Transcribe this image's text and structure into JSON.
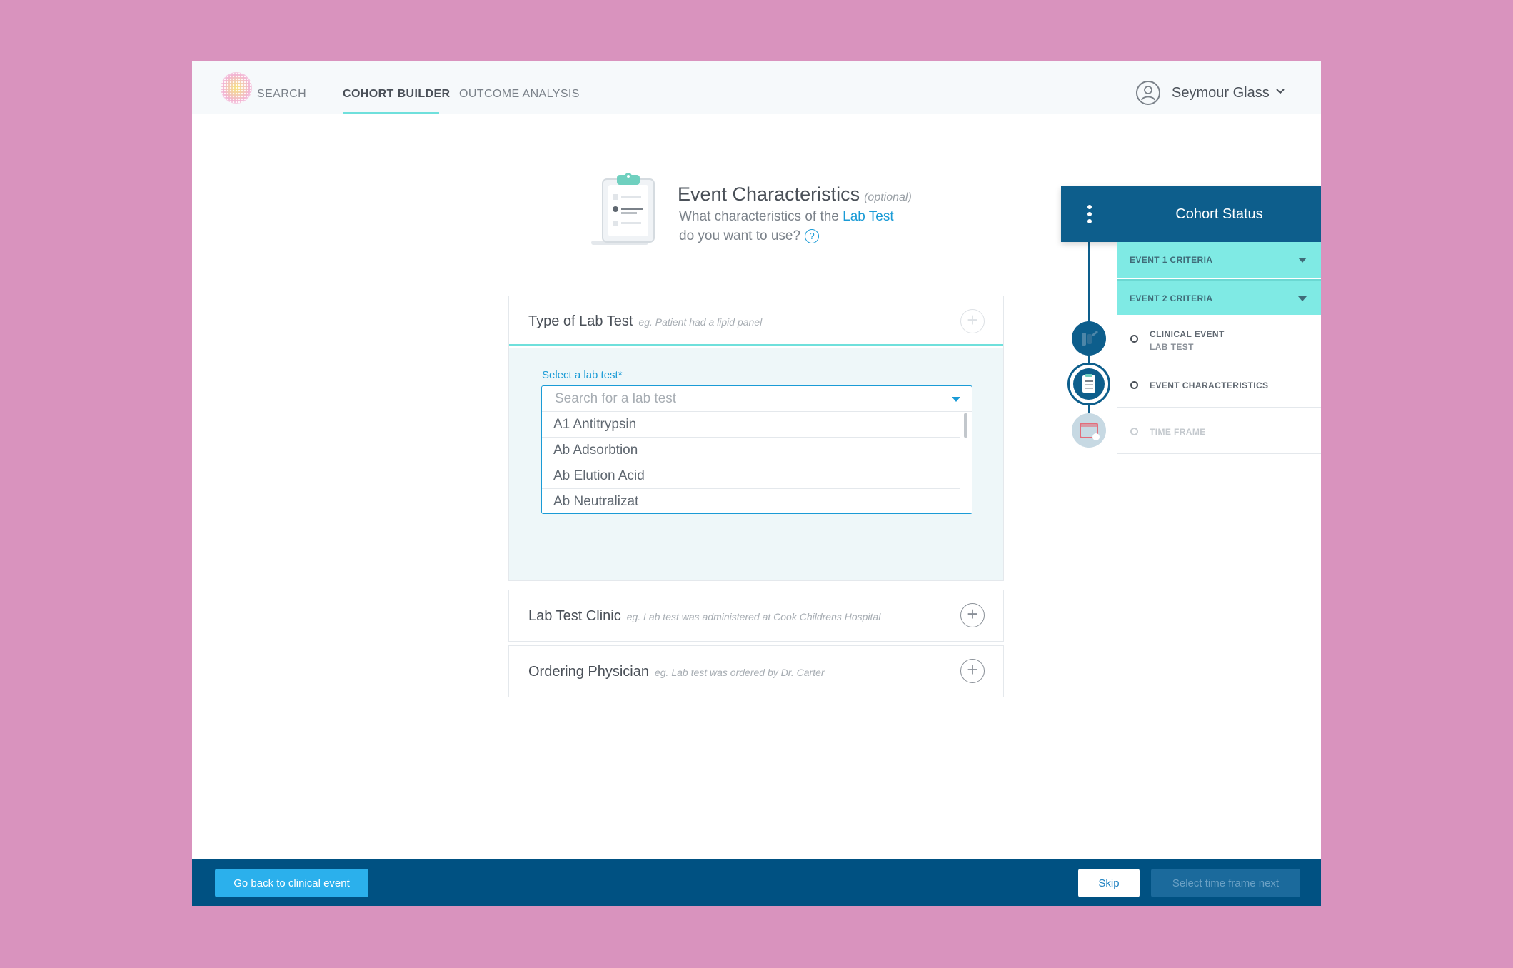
{
  "nav": {
    "items": [
      "SEARCH",
      "COHORT BUILDER",
      "OUTCOME ANALYSIS"
    ],
    "active": "COHORT BUILDER"
  },
  "user": {
    "name": "Seymour Glass"
  },
  "heading": {
    "title": "Event Characteristics",
    "optional": "(optional)",
    "subtitle_pre": "What characteristics of the",
    "subtitle_link": "Lab Test",
    "subtitle_post": "do you want to use?",
    "help": "?"
  },
  "panels": [
    {
      "title": "Type of Lab Test",
      "hint": "eg. Patient had a lipid panel"
    },
    {
      "title": "Lab Test Clinic",
      "hint": "eg. Lab test was administered at Cook Childrens Hospital"
    },
    {
      "title": "Ordering Physician",
      "hint": "eg. Lab test was ordered by Dr. Carter"
    }
  ],
  "lab_select": {
    "label": "Select a lab test*",
    "placeholder": "Search for a lab test",
    "options": [
      "A1 Antitrypsin",
      "Ab Adsorbtion",
      "Ab Elution Acid",
      "Ab Neutralizat"
    ]
  },
  "cohort_status": {
    "title": "Cohort Status",
    "criteria": [
      "EVENT 1 CRITERIA",
      "EVENT 2 CRITERIA"
    ],
    "steps": [
      {
        "label": "CLINICAL EVENT",
        "sub": "LAB TEST"
      },
      {
        "label": "EVENT CHARACTERISTICS",
        "sub": ""
      },
      {
        "label": "TIME FRAME",
        "sub": ""
      }
    ]
  },
  "footer": {
    "back": "Go back to clinical event",
    "skip": "Skip",
    "next": "Select time frame next"
  },
  "colors": {
    "primary": "#005182",
    "accent": "#6fe0dc",
    "link": "#1a9bd6",
    "background": "#d993be"
  }
}
